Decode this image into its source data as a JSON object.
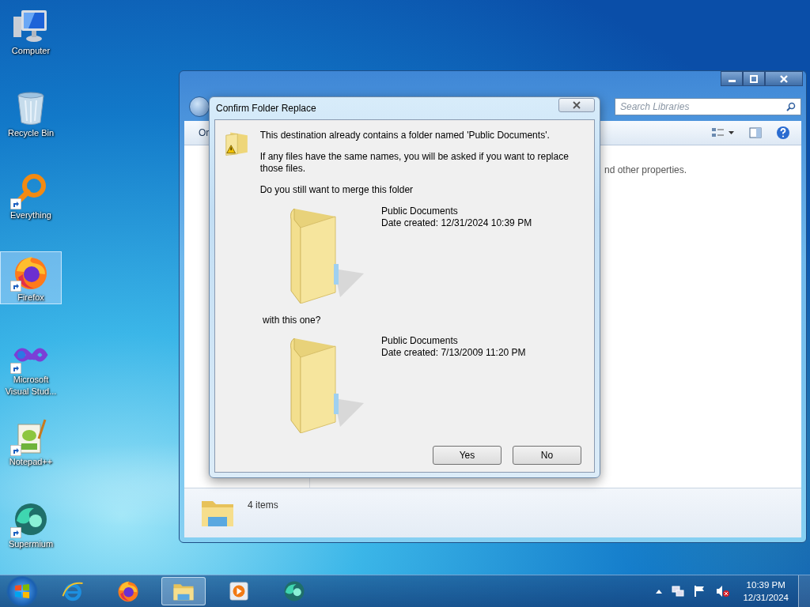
{
  "desktop_icons": [
    {
      "kind": "computer",
      "label": "Computer",
      "selected": false
    },
    {
      "kind": "recycle-bin",
      "label": "Recycle Bin",
      "selected": false
    },
    {
      "kind": "everything",
      "label": "Everything",
      "selected": false
    },
    {
      "kind": "firefox",
      "label": "Firefox",
      "selected": true
    },
    {
      "kind": "visual-studio",
      "label": "Microsoft Visual Stud...",
      "selected": false
    },
    {
      "kind": "notepad",
      "label": "Notepad++",
      "selected": false
    },
    {
      "kind": "supermium",
      "label": "Supermium",
      "selected": false
    }
  ],
  "explorer": {
    "search": {
      "placeholder": "Search Libraries"
    },
    "toolbar_text": "Or",
    "content_text": "nd other properties.",
    "status": "4 items"
  },
  "dialog": {
    "title": "Confirm Folder Replace",
    "message": "This destination already contains a folder named 'Public Documents'.",
    "detail": "If any files have the same names, you will be asked if you want to replace those files.",
    "question": "Do you still want to merge this folder",
    "folders": [
      {
        "name": "Public Documents",
        "date": "Date created: 12/31/2024 10:39 PM"
      },
      {
        "name": "Public Documents",
        "date": "Date created: 7/13/2009 11:20 PM"
      }
    ],
    "connector": "with this one?",
    "buttons": [
      "Yes",
      "No"
    ]
  },
  "taskbar": {
    "apps": [
      {
        "kind": "browser-e",
        "selected": false
      },
      {
        "kind": "firefox",
        "selected": false
      },
      {
        "kind": "explorer",
        "selected": true
      },
      {
        "kind": "media",
        "selected": false
      },
      {
        "kind": "supermium",
        "selected": false
      }
    ],
    "time": "10:39 PM",
    "date": "12/31/2024"
  }
}
